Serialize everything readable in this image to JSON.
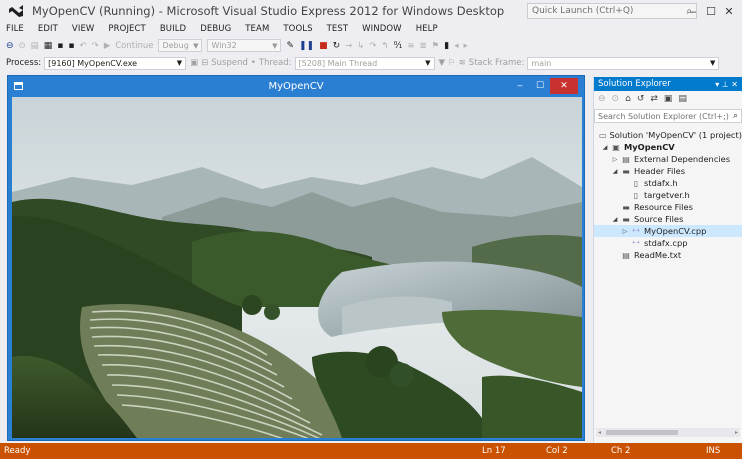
{
  "window": {
    "title": "MyOpenCV (Running) - Microsoft Visual Studio Express 2012 for Windows Desktop",
    "quick_launch_placeholder": "Quick Launch (Ctrl+Q)",
    "minimize": "‒",
    "maximize": "☐",
    "close": "✕"
  },
  "menu": [
    "FILE",
    "EDIT",
    "VIEW",
    "PROJECT",
    "BUILD",
    "DEBUG",
    "TEAM",
    "TOOLS",
    "TEST",
    "WINDOW",
    "HELP"
  ],
  "toolbar": {
    "continue_label": "Continue",
    "config_value": "Debug",
    "platform_value": "Win32"
  },
  "debug_toolbar": {
    "process_label": "Process:",
    "process_value": "[9160] MyOpenCV.exe",
    "suspend_label": "Suspend",
    "thread_label": "Thread:",
    "thread_value": "[5208] Main Thread",
    "stack_frame_label": "Stack Frame:",
    "stack_frame_value": "main"
  },
  "image_window": {
    "title": "MyOpenCV",
    "minimize": "‒",
    "maximize": "☐",
    "close": "✕"
  },
  "solution_explorer": {
    "title": "Solution Explorer",
    "search_placeholder": "Search Solution Explorer (Ctrl+;)",
    "items": [
      {
        "label": "Solution 'MyOpenCV' (1 project)",
        "indent": 0,
        "arrow": "",
        "icon": "solution-icon",
        "bold": false
      },
      {
        "label": "MyOpenCV",
        "indent": 1,
        "arrow": "◢",
        "icon": "project-icon",
        "bold": true
      },
      {
        "label": "External Dependencies",
        "indent": 2,
        "arrow": "▷",
        "icon": "dependencies-icon",
        "bold": false
      },
      {
        "label": "Header Files",
        "indent": 2,
        "arrow": "◢",
        "icon": "folder-icon",
        "bold": false
      },
      {
        "label": "stdafx.h",
        "indent": 3,
        "arrow": "",
        "icon": "header-file-icon",
        "bold": false
      },
      {
        "label": "targetver.h",
        "indent": 3,
        "arrow": "",
        "icon": "header-file-icon",
        "bold": false
      },
      {
        "label": "Resource Files",
        "indent": 2,
        "arrow": "",
        "icon": "folder-icon",
        "bold": false
      },
      {
        "label": "Source Files",
        "indent": 2,
        "arrow": "◢",
        "icon": "folder-icon",
        "bold": false
      },
      {
        "label": "MyOpenCV.cpp",
        "indent": 3,
        "arrow": "▷",
        "icon": "cpp-file-icon",
        "bold": false,
        "selected": true
      },
      {
        "label": "stdafx.cpp",
        "indent": 3,
        "arrow": "",
        "icon": "cpp-file-icon",
        "bold": false
      },
      {
        "label": "ReadMe.txt",
        "indent": 2,
        "arrow": "",
        "icon": "text-file-icon",
        "bold": false
      }
    ]
  },
  "status": {
    "left": "Ready",
    "line": "Ln 17",
    "col": "Col 2",
    "ch": "Ch 2",
    "mode": "INS"
  },
  "colors": {
    "accent": "#007acc",
    "status_bar": "#ca5100",
    "image_window_frame": "#2b7fd2",
    "image_window_close": "#c7312f"
  }
}
